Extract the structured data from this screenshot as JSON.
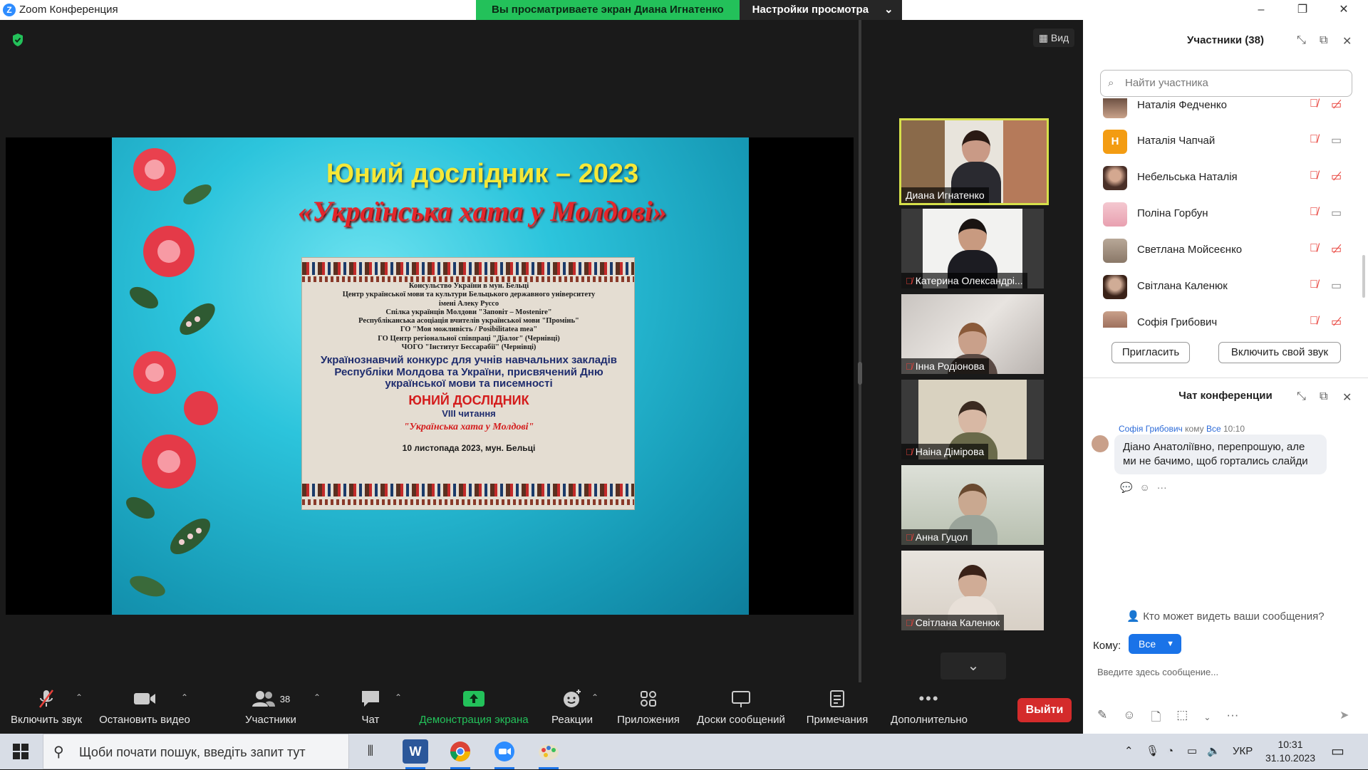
{
  "window": {
    "title": "Zoom Конференция",
    "logo_letter": "Z"
  },
  "share_banner": {
    "viewing": "Вы просматриваете экран Диана Игнатенко",
    "settings": "Настройки просмотра"
  },
  "view_button": "Вид",
  "slide": {
    "title": "Юний дослідник – 2023",
    "subtitle": "«Українська хата у Молдові»",
    "card_lines": [
      "Консульство України в мун. Бельці",
      "Центр української мови та культури Бельцького державного університету",
      "імені Алеку Руссо",
      "Спілка українців Молдови \"Заповіт – Mostenire\"",
      "Республіканська асоціація вчителів української мови \"Промінь\"",
      "ГО \"Моя можливість / Posibilitatea mea\"",
      "ГО Центр регіональної співпраці \"Діалог\" (Чернівці)",
      "ЧОГО \"Інститут Бессарабії\" (Чернівці)"
    ],
    "contest": "Українознавчий конкурс для учнів навчальних закладів Республіки Молдова та України, присвячений Дню української мови та писемності",
    "name": "ЮНИЙ ДОСЛІДНИК",
    "reading": "VIII читання",
    "theme": "\"Українська хата у Молдові\"",
    "date": "10 листопада 2023, мун. Бельці"
  },
  "tiles": [
    {
      "name": "Диана Игнатенко",
      "muted": false,
      "active": true
    },
    {
      "name": "Катерина Олександрі...",
      "muted": true,
      "active": false
    },
    {
      "name": "Інна Родіонова",
      "muted": true,
      "active": false
    },
    {
      "name": "Наіна Дімірова",
      "muted": true,
      "active": false
    },
    {
      "name": "Анна Гуцол",
      "muted": true,
      "active": false
    },
    {
      "name": "Світлана Каленюк",
      "muted": true,
      "active": false
    }
  ],
  "toolbar": {
    "unmute": "Включить звук",
    "stop_video": "Остановить видео",
    "participants": "Участники",
    "participants_count": "38",
    "chat": "Чат",
    "share": "Демонстрация экрана",
    "reactions": "Реакции",
    "apps": "Приложения",
    "whiteboards": "Доски сообщений",
    "notes": "Примечания",
    "more": "Дополнительно",
    "leave": "Выйти"
  },
  "participants_panel": {
    "title": "Участники (38)",
    "search_placeholder": "Найти участника",
    "list": [
      {
        "name": "Наталія Федченко",
        "video_off": true
      },
      {
        "name": "Наталія Чапчай",
        "video_off": false,
        "initial": "Н"
      },
      {
        "name": "Небельська Наталія",
        "video_off": true
      },
      {
        "name": "Поліна Горбун",
        "video_off": false
      },
      {
        "name": "Светлана Мойсеєнко",
        "video_off": true
      },
      {
        "name": "Світлана Каленюк",
        "video_off": false
      },
      {
        "name": "Софія Грибович",
        "video_off": true
      }
    ],
    "invite": "Пригласить",
    "unmute_me": "Включить свой звук"
  },
  "chat_panel": {
    "title": "Чат конференции",
    "message": {
      "sender": "Софія Грибович",
      "to_word": "кому",
      "to": "Все",
      "time": "10:10",
      "text": "Діано Анатоліївно, перепрошую, але ми не бачимо, щоб гортались слайди"
    },
    "who_can_see": "Кто может видеть ваши сообщения?",
    "to_label": "Кому:",
    "to_value": "Все",
    "input_placeholder": "Введите здесь сообщение..."
  },
  "taskbar": {
    "search_placeholder": "Щоби почати пошук, введіть запит тут",
    "lang": "УКР",
    "time": "10:31",
    "date": "31.10.2023"
  },
  "colors": {
    "accent": "#23c15a",
    "zoom_blue": "#2d8cff",
    "leave": "#d42b2b",
    "muted": "#e8413a"
  }
}
